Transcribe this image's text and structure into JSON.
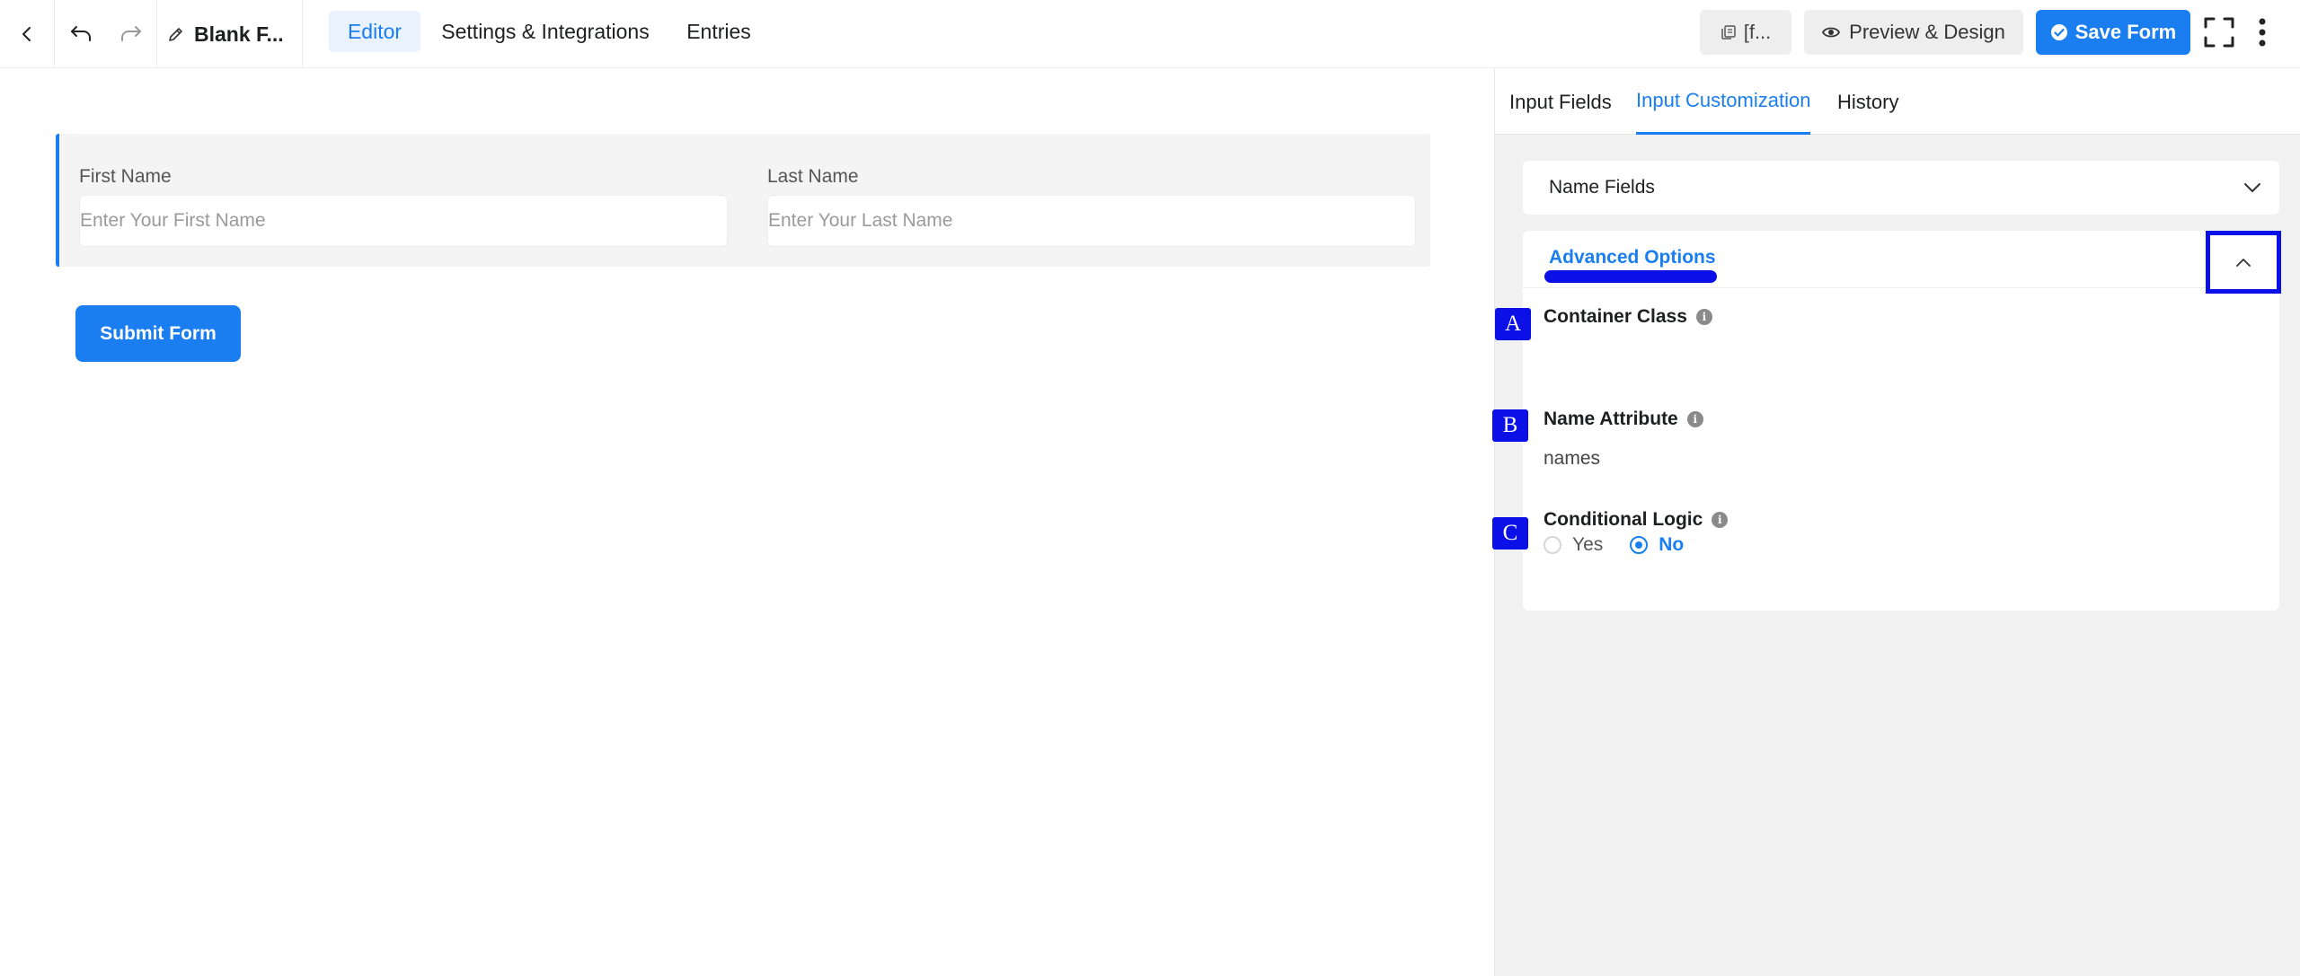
{
  "toolbar": {
    "form_title": "Blank F...",
    "shortcode_label": "[f...",
    "preview_label": "Preview & Design",
    "save_label": "Save Form"
  },
  "nav": {
    "tabs": [
      {
        "label": "Editor",
        "active": true
      },
      {
        "label": "Settings & Integrations",
        "active": false
      },
      {
        "label": "Entries",
        "active": false
      }
    ]
  },
  "form": {
    "first_name": {
      "label": "First Name",
      "placeholder": "Enter Your First Name"
    },
    "last_name": {
      "label": "Last Name",
      "placeholder": "Enter Your Last Name"
    },
    "submit_label": "Submit Form"
  },
  "panel": {
    "tabs": [
      {
        "label": "Input Fields",
        "active": false
      },
      {
        "label": "Input Customization",
        "active": true
      },
      {
        "label": "History",
        "active": false
      }
    ],
    "name_fields_title": "Name Fields",
    "advanced": {
      "title": "Advanced Options",
      "container_class_label": "Container Class",
      "name_attribute_label": "Name Attribute",
      "name_attribute_value": "names",
      "conditional_logic_label": "Conditional Logic",
      "conditional_options": [
        {
          "label": "Yes",
          "selected": false
        },
        {
          "label": "No",
          "selected": true
        }
      ]
    }
  },
  "markers": [
    "A",
    "B",
    "C"
  ],
  "colors": {
    "accent": "#1a7ef0",
    "annotation": "#0b10e6",
    "panel_bg": "#f1f1f1"
  },
  "icons": [
    "back-arrow-icon",
    "undo-icon",
    "redo-icon",
    "edit-pencil-icon",
    "copy-icon",
    "eye-icon",
    "check-circle-icon",
    "fullscreen-icon",
    "more-vertical-icon",
    "chevron-down-icon",
    "chevron-up-icon",
    "info-icon"
  ]
}
